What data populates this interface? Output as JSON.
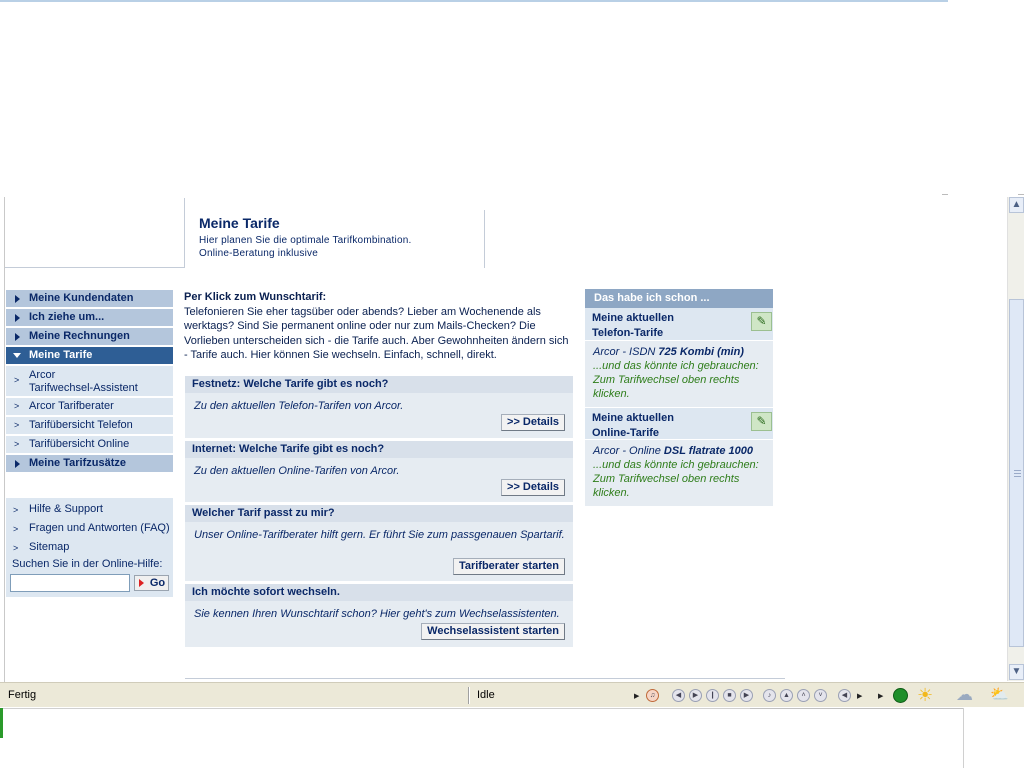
{
  "header": {
    "title": "Meine Tarife",
    "subtitle_line1": "Hier planen Sie die optimale Tarifkombination.",
    "subtitle_line2": "Online-Beratung inklusive"
  },
  "nav": {
    "main1": "Meine Kundendaten",
    "main2": "Ich ziehe um...",
    "main3": "Meine Rechnungen",
    "main4": "Meine Tarife",
    "sub1_line1": "Arcor",
    "sub1_line2": "Tarifwechsel-Assistent",
    "sub2": "Arcor Tarifberater",
    "sub3": "Tarifübersicht Telefon",
    "sub4": "Tarifübersicht Online",
    "main5": "Meine Tarifzusätze",
    "marker": ">"
  },
  "help": {
    "item1": "Hilfe & Support",
    "item2": "Fragen und Antworten (FAQ)",
    "item3": "Sitemap",
    "search_label": "Suchen Sie in der Online-Hilfe:",
    "search_value": "",
    "go_label": "Go"
  },
  "intro": {
    "title": "Per Klick zum Wunschtarif:",
    "text": "Telefonieren Sie eher tagsüber oder abends? Lieber am Wochenende als werktags? Sind Sie permanent online oder nur zum Mails-Checken? Die Vorlieben unterscheiden sich - die Tarife auch. Aber Gewohnheiten ändern sich - Tarife auch. Hier können Sie wechseln. Einfach, schnell, direkt."
  },
  "panels": {
    "p1": {
      "title": "Festnetz: Welche Tarife gibt es noch?",
      "body": "Zu den aktuellen Telefon-Tarifen von Arcor.",
      "button": ">> Details"
    },
    "p2": {
      "title": "Internet: Welche Tarife gibt es noch?",
      "body": "Zu den aktuellen Online-Tarifen von Arcor.",
      "button": ">> Details"
    },
    "p3": {
      "title": "Welcher Tarif passt zu mir?",
      "body": "Unser Online-Tarifberater hilft gern. Er führt Sie zum passgenauen Spartarif.",
      "button": "Tarifberater starten"
    },
    "p4": {
      "title": "Ich möchte sofort wechseln.",
      "body": "Sie kennen Ihren Wunschtarif schon? Hier geht's zum Wechselassistenten.",
      "button": "Wechselassistent starten"
    }
  },
  "right": {
    "head": "Das habe ich schon ...",
    "sec1_line1": "Meine aktuellen",
    "sec1_line2": "Telefon-Tarife",
    "tariff1_prefix": "Arcor - ISDN ",
    "tariff1_name": "725 Kombi (min)",
    "sec2_line1": "Meine aktuellen",
    "sec2_line2": "Online-Tarife",
    "tariff2_prefix": "Arcor - Online ",
    "tariff2_name": "DSL flatrate 1000",
    "hint": "...und das könnte ich gebrauchen: Zum Tarifwechsel oben rechts klicken."
  },
  "status": {
    "left": "Fertig",
    "right": "Idle"
  },
  "colors": {
    "nav_active": "#2e5e95",
    "nav_main": "#b4c6dc",
    "panel_bg": "#e6ecf2",
    "hint_green": "#2e7d1a"
  }
}
